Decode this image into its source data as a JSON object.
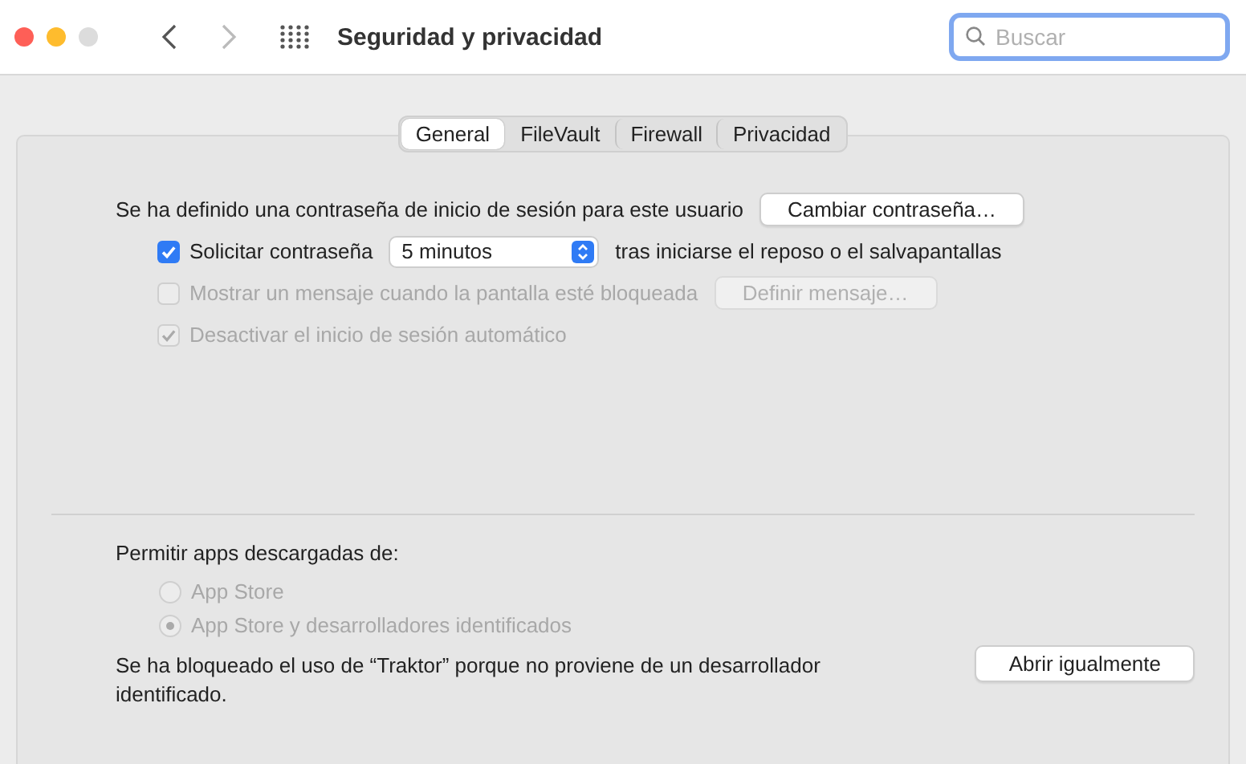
{
  "window": {
    "title": "Seguridad y privacidad"
  },
  "nav": {
    "back_enabled": true,
    "forward_enabled": false
  },
  "search": {
    "placeholder": "Buscar",
    "focused": true
  },
  "tabs": [
    {
      "label": "General",
      "selected": true
    },
    {
      "label": "FileVault",
      "selected": false
    },
    {
      "label": "Firewall",
      "selected": false
    },
    {
      "label": "Privacidad",
      "selected": false
    }
  ],
  "general": {
    "password_text": "Se ha definido una contraseña de inicio de sesión para este usuario",
    "change_button": "Cambiar contraseña…",
    "options": [
      {
        "kind": "checkbox-select",
        "label": "Solicitar contraseña",
        "checked": true,
        "disabled": false,
        "select_value": "5 minutos",
        "suffix": "tras iniciarse el reposo o el salvapantallas"
      },
      {
        "kind": "checkbox-button",
        "label": "Mostrar un mensaje cuando la pantalla esté bloqueada",
        "checked": false,
        "disabled": true,
        "button": "Definir mensaje…"
      },
      {
        "kind": "checkbox",
        "label": "Desactivar el inicio de sesión automático",
        "checked": true,
        "disabled": true
      }
    ]
  },
  "downloads": {
    "heading": "Permitir apps descargadas de:",
    "sources": [
      {
        "label": "App Store",
        "selected": false,
        "disabled": true
      },
      {
        "label": "App Store y desarrolladores identificados",
        "selected": true,
        "disabled": true
      }
    ],
    "blocked_message": "Se ha bloqueado el uso de “Traktor” porque no proviene de un desarrollador identificado.",
    "open_button": "Abrir igualmente"
  }
}
